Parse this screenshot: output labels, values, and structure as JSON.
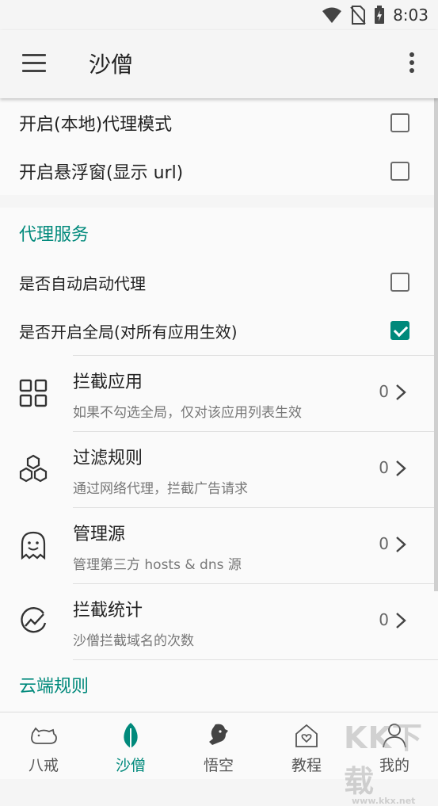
{
  "status_bar": {
    "time": "8:03",
    "icons": [
      "wifi-icon",
      "no-sim-icon",
      "battery-charging-icon"
    ]
  },
  "app_bar": {
    "title": "沙僧",
    "menu_icon": "menu-icon",
    "more_icon": "more-vert-icon"
  },
  "toggles_top": [
    {
      "label": "开启(本地)代理模式",
      "checked": false
    },
    {
      "label": "开启悬浮窗(显示 url)",
      "checked": false
    }
  ],
  "proxy_section": {
    "title": "代理服务",
    "toggles": [
      {
        "label": "是否自动启动代理",
        "checked": false
      },
      {
        "label": "是否开启全局(对所有应用生效)",
        "checked": true
      }
    ],
    "items": [
      {
        "icon": "grid-apps-icon",
        "title": "拦截应用",
        "subtitle": "如果不勾选全局，仅对该应用列表生效",
        "count": "0"
      },
      {
        "icon": "hexagons-icon",
        "title": "过滤规则",
        "subtitle": "通过网络代理，拦截广告请求",
        "count": "0"
      },
      {
        "icon": "ghost-icon",
        "title": "管理源",
        "subtitle": "管理第三方 hosts & dns 源",
        "count": "0"
      },
      {
        "icon": "chart-trend-icon",
        "title": "拦截统计",
        "subtitle": "沙僧拦截域名的次数",
        "count": "0"
      }
    ]
  },
  "cloud_section": {
    "title": "云端规则"
  },
  "bottom_nav": {
    "tabs": [
      {
        "label": "八戒",
        "icon": "pig-icon",
        "active": false
      },
      {
        "label": "沙僧",
        "icon": "leaf-icon",
        "active": true
      },
      {
        "label": "悟空",
        "icon": "monkey-icon",
        "active": false
      },
      {
        "label": "教程",
        "icon": "home-heart-icon",
        "active": false
      },
      {
        "label": "我的",
        "icon": "person-icon",
        "active": false
      }
    ]
  },
  "watermark": {
    "text": "KK下载",
    "url": "www.kkx.net"
  },
  "colors": {
    "accent": "#00897b",
    "background": "#f5f5f5",
    "card": "#fafafa",
    "secondary_text": "#777777"
  }
}
